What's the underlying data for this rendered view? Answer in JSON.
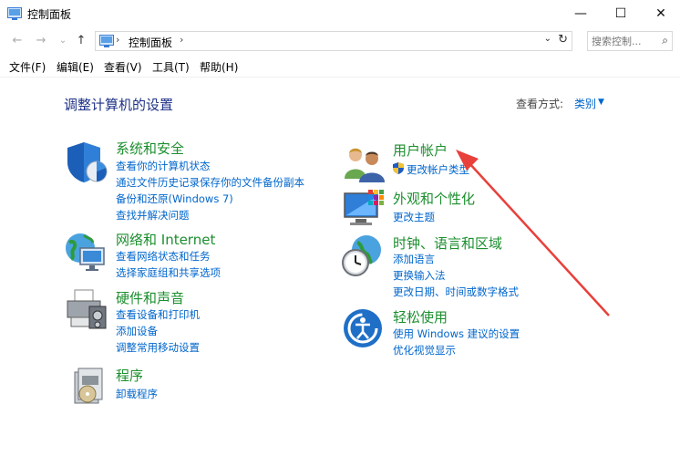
{
  "window": {
    "title": "控制面板",
    "min": "—",
    "max": "☐",
    "close": "✕"
  },
  "nav": {
    "back": "←",
    "forward": "→",
    "recent": "⌄",
    "up": "↑"
  },
  "address": {
    "crumb": "控制面板",
    "sep1": "›",
    "sep2": "›",
    "dropdown": "⌄",
    "refresh": "↻"
  },
  "search": {
    "placeholder": "搜索控制...",
    "icon": "⌕"
  },
  "menu": {
    "file": "文件(F)",
    "edit": "编辑(E)",
    "view": "查看(V)",
    "tools": "工具(T)",
    "help": "帮助(H)"
  },
  "main": {
    "heading": "调整计算机的设置",
    "view_by_label": "查看方式:",
    "view_by_value": "类别",
    "view_by_caret": "▼"
  },
  "categories": {
    "system": {
      "title": "系统和安全",
      "links": [
        "查看你的计算机状态",
        "通过文件历史记录保存你的文件备份副本",
        "备份和还原(Windows 7)",
        "查找并解决问题"
      ]
    },
    "network": {
      "title": "网络和 Internet",
      "links": [
        "查看网络状态和任务",
        "选择家庭组和共享选项"
      ]
    },
    "hardware": {
      "title": "硬件和声音",
      "links": [
        "查看设备和打印机",
        "添加设备",
        "调整常用移动设置"
      ]
    },
    "programs": {
      "title": "程序",
      "links": [
        "卸载程序"
      ]
    },
    "users": {
      "title": "用户帐户",
      "links": [
        "更改帐户类型"
      ]
    },
    "appearance": {
      "title": "外观和个性化",
      "links": [
        "更改主题"
      ]
    },
    "clock": {
      "title": "时钟、语言和区域",
      "links": [
        "添加语言",
        "更换输入法",
        "更改日期、时间或数字格式"
      ]
    },
    "ease": {
      "title": "轻松使用",
      "links": [
        "使用 Windows 建议的设置",
        "优化视觉显示"
      ]
    }
  },
  "colors": {
    "heading": "#1e3287",
    "category_title": "#1c8f2e",
    "link": "#0066cc",
    "annotation_arrow": "#e8403a"
  }
}
